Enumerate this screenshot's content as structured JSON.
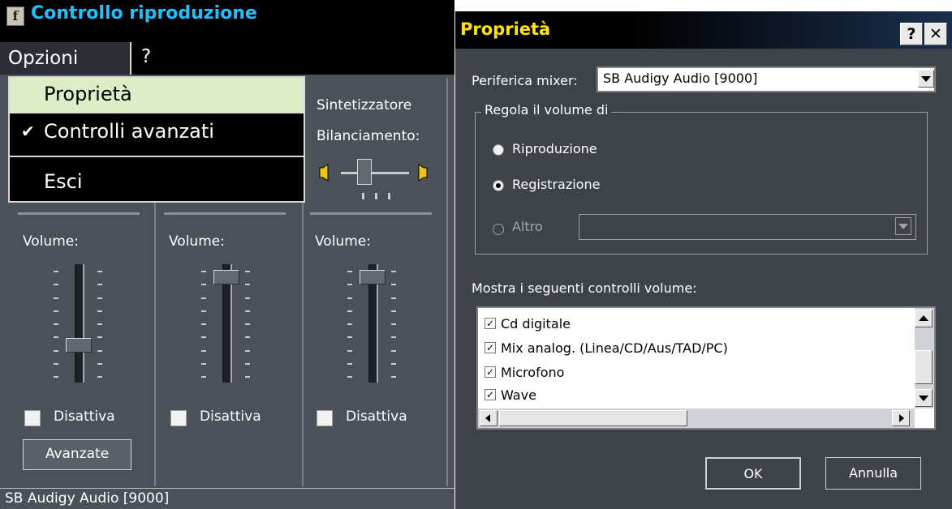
{
  "left_window": {
    "title": "Controllo riproduzione",
    "menu": {
      "options": "Opzioni",
      "help": "?"
    },
    "dropdown": {
      "items": [
        "Proprietà",
        "Controlli avanzati",
        "Esci"
      ],
      "check_mark": "✔"
    },
    "synth_label": "Sintetizzatore",
    "balance_label": "Bilanciamento:",
    "columns": [
      {
        "volume_label": "Volume:",
        "mute_label": "Disattiva",
        "volume_level": 0.3
      },
      {
        "volume_label": "Volume:",
        "mute_label": "Disattiva",
        "volume_level": 0.95
      },
      {
        "volume_label": "Volume:",
        "mute_label": "Disattiva",
        "volume_level": 0.95
      }
    ],
    "advanced_button": "Avanzate",
    "status": "SB Audigy Audio [9000]"
  },
  "right_window": {
    "title": "Proprietà",
    "help_button": "?",
    "close_button": "✕",
    "mixer_label": "Periferica mixer:",
    "mixer_value": "SB Audigy Audio [9000]",
    "group_label": "Regola il volume di",
    "radios": [
      {
        "label": "Riproduzione",
        "selected": false,
        "enabled": true
      },
      {
        "label": "Registrazione",
        "selected": true,
        "enabled": true
      },
      {
        "label": "Altro",
        "selected": false,
        "enabled": false
      }
    ],
    "controls_label": "Mostra i seguenti controlli volume:",
    "controls": [
      {
        "label": "Cd digitale",
        "checked": true
      },
      {
        "label": "Mix analog. (Linea/CD/Aus/TAD/PC)",
        "checked": true
      },
      {
        "label": "Microfono",
        "checked": true
      },
      {
        "label": "Wave",
        "checked": true
      }
    ],
    "ok_button": "OK",
    "cancel_button": "Annulla"
  },
  "colors": {
    "title_left": "#1ec0ff",
    "title_right": "#ffe600",
    "menu_highlight": "#dcedc8"
  }
}
